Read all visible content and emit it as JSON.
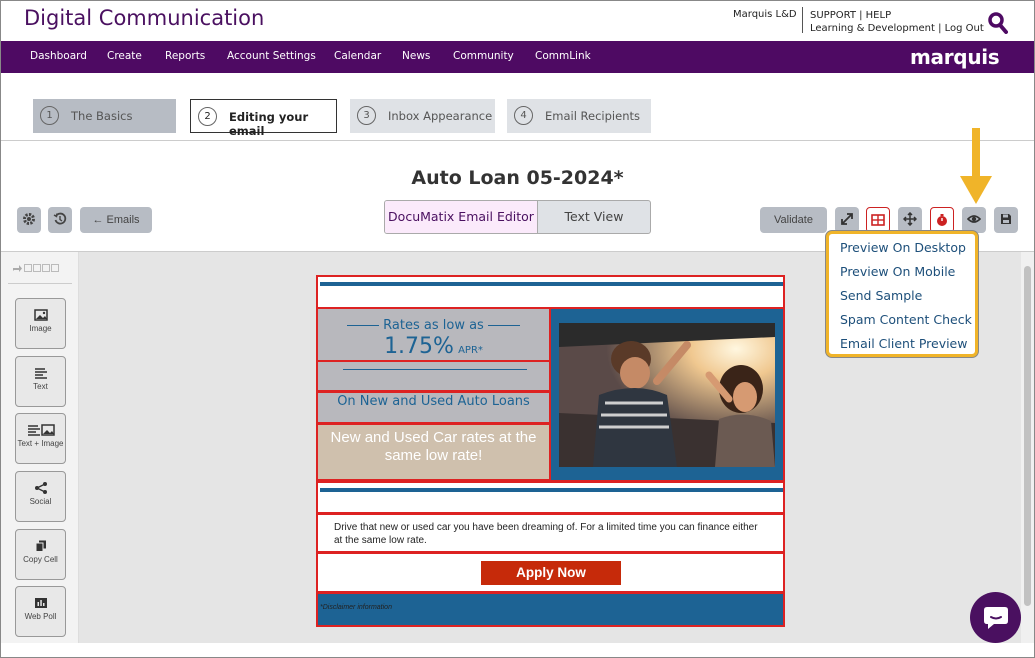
{
  "app": {
    "title": "Digital Communication"
  },
  "header": {
    "user": "Marquis L&D",
    "links_line1": "SUPPORT | HELP",
    "links_line2": "Learning & Development | Log Out"
  },
  "nav": {
    "items": [
      "Dashboard",
      "Create",
      "Reports",
      "Account Settings",
      "Calendar",
      "News",
      "Community",
      "CommLink"
    ],
    "brand": "marquis"
  },
  "steps": [
    {
      "num": "1",
      "label": "The Basics"
    },
    {
      "num": "2",
      "label": "Editing your email"
    },
    {
      "num": "3",
      "label": "Inbox Appearance"
    },
    {
      "num": "4",
      "label": "Email Recipients"
    }
  ],
  "editor": {
    "email_title": "Auto Loan 05-2024*",
    "emails_button": "← Emails",
    "toggle_left": "DocuMatix Email Editor",
    "toggle_right": "Text View",
    "validate_button": "Validate"
  },
  "preview_menu": {
    "items": [
      "Preview On Desktop",
      "Preview On Mobile",
      "Send Sample",
      "Spam Content Check",
      "Email Client Preview"
    ]
  },
  "tools": [
    "Image",
    "Text",
    "Text + Image",
    "Social",
    "Copy Cell",
    "Web Poll"
  ],
  "email": {
    "rates_label": "Rates as low as",
    "rate_value": "1.75%",
    "rate_unit": "APR*",
    "subheading": "On New and Used Auto Loans",
    "tagline": "New and Used Car rates at the same low rate!",
    "body": "Drive that new or used car you have been dreaming of.  For a limited time you can finance either at the same low rate.",
    "cta": "Apply Now",
    "disclaimer": "*Disclaimer information"
  },
  "colors": {
    "nav": "#4e0a63",
    "accent_blue": "#1d6394",
    "highlight": "#f0b429",
    "cta": "#c62a0a",
    "block_outline": "#dd2222"
  }
}
